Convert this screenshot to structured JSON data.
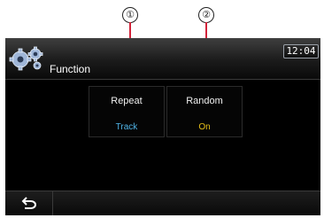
{
  "callouts": [
    "①",
    "②"
  ],
  "header": {
    "title": "Function",
    "clock": "12:04"
  },
  "options": [
    {
      "label": "Repeat",
      "value": "Track",
      "value_color": "#4fb4e8"
    },
    {
      "label": "Random",
      "value": "On",
      "value_color": "#e9c21a"
    }
  ],
  "icons": {
    "header": "gear-icon",
    "back": "back-arrow-icon"
  },
  "colors": {
    "callout_line": "#d2233a",
    "screen_bg": "#000000"
  }
}
